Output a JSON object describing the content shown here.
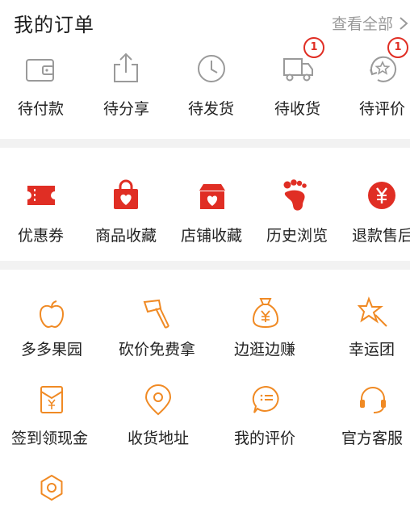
{
  "header": {
    "title": "我的订单",
    "view_all": "查看全部"
  },
  "orders": [
    {
      "label": "待付款",
      "icon": "wallet-icon"
    },
    {
      "label": "待分享",
      "icon": "share-icon"
    },
    {
      "label": "待发货",
      "icon": "clock-icon"
    },
    {
      "label": "待收货",
      "icon": "truck-icon",
      "badge": "1"
    },
    {
      "label": "待评价",
      "icon": "review-star-icon",
      "badge": "1"
    }
  ],
  "favorites": [
    {
      "label": "优惠券",
      "icon": "coupon-icon"
    },
    {
      "label": "商品收藏",
      "icon": "bag-heart-icon"
    },
    {
      "label": "店铺收藏",
      "icon": "store-heart-icon"
    },
    {
      "label": "历史浏览",
      "icon": "footprint-icon"
    },
    {
      "label": "退款售后",
      "icon": "yen-circle-icon"
    }
  ],
  "services": [
    {
      "label": "多多果园",
      "icon": "apple-icon"
    },
    {
      "label": "砍价免费拿",
      "icon": "axe-icon"
    },
    {
      "label": "边逛边赚",
      "icon": "money-bag-icon"
    },
    {
      "label": "幸运团",
      "icon": "lucky-star-icon"
    },
    {
      "label": "签到领现金",
      "icon": "checkin-envelope-icon"
    },
    {
      "label": "收货地址",
      "icon": "location-pin-icon"
    },
    {
      "label": "我的评价",
      "icon": "comment-icon"
    },
    {
      "label": "官方客服",
      "icon": "headset-icon"
    },
    {
      "label": "",
      "icon": "settings-gear-icon"
    }
  ],
  "colors": {
    "accent_red": "#e02e24",
    "accent_orange": "#f08a24",
    "icon_gray": "#9a9a9a"
  }
}
